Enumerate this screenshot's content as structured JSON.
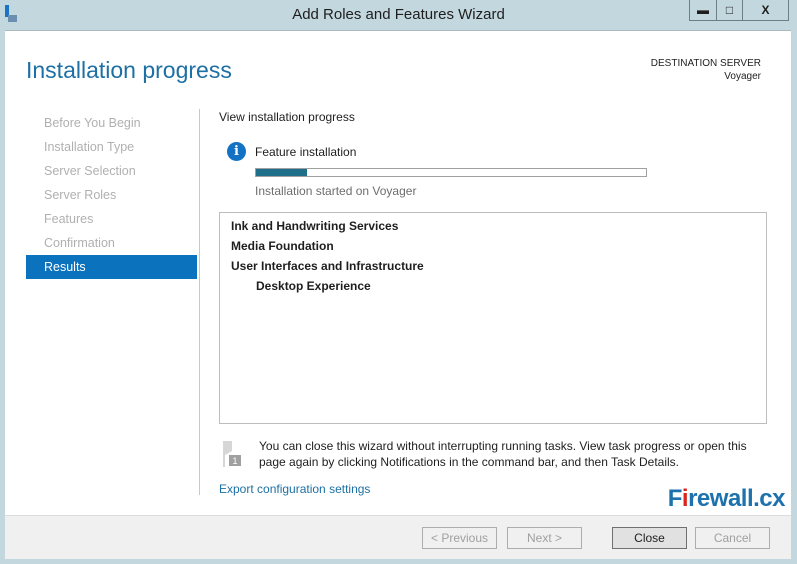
{
  "window": {
    "title": "Add Roles and Features Wizard",
    "minimize": "▬",
    "maximize": "□",
    "close": "X"
  },
  "header": {
    "title": "Installation progress",
    "dest_label": "DESTINATION SERVER",
    "dest_server": "Voyager"
  },
  "nav": [
    {
      "label": "Before You Begin",
      "active": false
    },
    {
      "label": "Installation Type",
      "active": false
    },
    {
      "label": "Server Selection",
      "active": false
    },
    {
      "label": "Server Roles",
      "active": false
    },
    {
      "label": "Features",
      "active": false
    },
    {
      "label": "Confirmation",
      "active": false
    },
    {
      "label": "Results",
      "active": true
    }
  ],
  "main": {
    "heading": "View installation progress",
    "status_title": "Feature installation",
    "progress_percent": 13,
    "status_text": "Installation started on Voyager",
    "features": [
      {
        "label": "Ink and Handwriting Services",
        "sub": false
      },
      {
        "label": "Media Foundation",
        "sub": false
      },
      {
        "label": "User Interfaces and Infrastructure",
        "sub": false
      },
      {
        "label": "Desktop Experience",
        "sub": true
      }
    ],
    "note": "You can close this wizard without interrupting running tasks. View task progress or open this page again by clicking Notifications in the command bar, and then Task Details.",
    "notification_count": "1",
    "export_link": "Export configuration settings"
  },
  "watermark": "Firewall.cx",
  "buttons": {
    "previous": "< Previous",
    "next": "Next >",
    "close": "Close",
    "cancel": "Cancel"
  },
  "colors": {
    "accent": "#0b72bd",
    "progress": "#1f6f8b"
  }
}
